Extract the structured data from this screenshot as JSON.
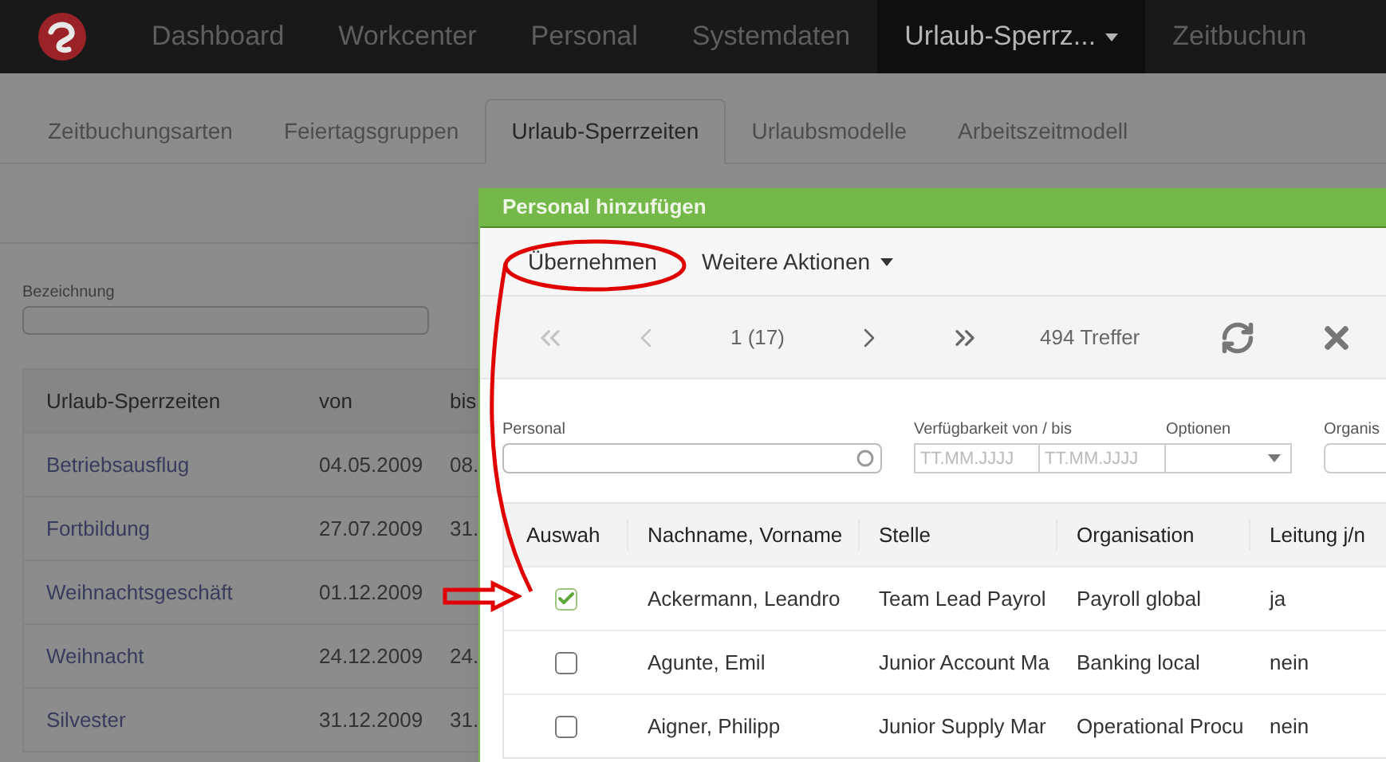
{
  "nav": {
    "items": [
      {
        "label": "Dashboard",
        "selected": false,
        "dropdown": false
      },
      {
        "label": "Workcenter",
        "selected": false,
        "dropdown": false
      },
      {
        "label": "Personal",
        "selected": false,
        "dropdown": false
      },
      {
        "label": "Systemdaten",
        "selected": false,
        "dropdown": false
      },
      {
        "label": "Urlaub-Sperrz...",
        "selected": true,
        "dropdown": true
      },
      {
        "label": "Zeitbuchun",
        "selected": false,
        "dropdown": false
      }
    ]
  },
  "subtabs": [
    {
      "label": "Zeitbuchungsarten",
      "selected": false
    },
    {
      "label": "Feiertagsgruppen",
      "selected": false
    },
    {
      "label": "Urlaub-Sperrzeiten",
      "selected": true
    },
    {
      "label": "Urlaubsmodelle",
      "selected": false
    },
    {
      "label": "Arbeitszeitmodell",
      "selected": false
    }
  ],
  "filter": {
    "label": "Bezeichnung"
  },
  "table": {
    "columns": [
      "Urlaub-Sperrzeiten",
      "von",
      "bis"
    ],
    "rows": [
      {
        "name": "Betriebsausflug",
        "von": "04.05.2009",
        "bis": "08."
      },
      {
        "name": "Fortbildung",
        "von": "27.07.2009",
        "bis": "31."
      },
      {
        "name": "Weihnachtsgeschäft",
        "von": "01.12.2009"
      },
      {
        "name": "Weihnacht",
        "von": "24.12.2009",
        "bis": "24."
      },
      {
        "name": "Silvester",
        "von": "31.12.2009",
        "bis": "31."
      }
    ]
  },
  "dialog": {
    "title": "Personal hinzufügen",
    "toolbar": [
      {
        "label": "Übernehmen",
        "dropdown": false
      },
      {
        "label": "Weitere Aktionen",
        "dropdown": true
      }
    ],
    "pager": {
      "buttons": [
        {
          "kind": "first",
          "disabled": true
        },
        {
          "kind": "prev",
          "disabled": true
        },
        {
          "kind": "page",
          "label": "1 (17)"
        },
        {
          "kind": "next",
          "disabled": false
        },
        {
          "kind": "last",
          "disabled": false
        }
      ],
      "hits": "494 Treffer"
    },
    "filters": {
      "personal": {
        "label": "Personal"
      },
      "availability": {
        "label": "Verfügbarkeit von / bis",
        "from_placeholder": "TT.MM.JJJJ",
        "to_placeholder": "TT.MM.JJJJ"
      },
      "options": {
        "label": "Optionen"
      },
      "organisation": {
        "label": "Organis"
      }
    },
    "table": {
      "columns": [
        "Auswah",
        "Nachname, Vorname",
        "Stelle",
        "Organisation",
        "Leitung j/n"
      ],
      "rows": [
        {
          "checked": true,
          "name": "Ackermann, Leandro",
          "position": "Team Lead Payrol",
          "organisation": "Payroll global",
          "lead": "ja"
        },
        {
          "checked": false,
          "name": "Agunte, Emil",
          "position": "Junior Account Ma",
          "organisation": "Banking local",
          "lead": "nein"
        },
        {
          "checked": false,
          "name": "Aigner, Philipp",
          "position": "Junior Supply Mar",
          "organisation": "Operational Procu",
          "lead": "nein"
        }
      ]
    }
  }
}
